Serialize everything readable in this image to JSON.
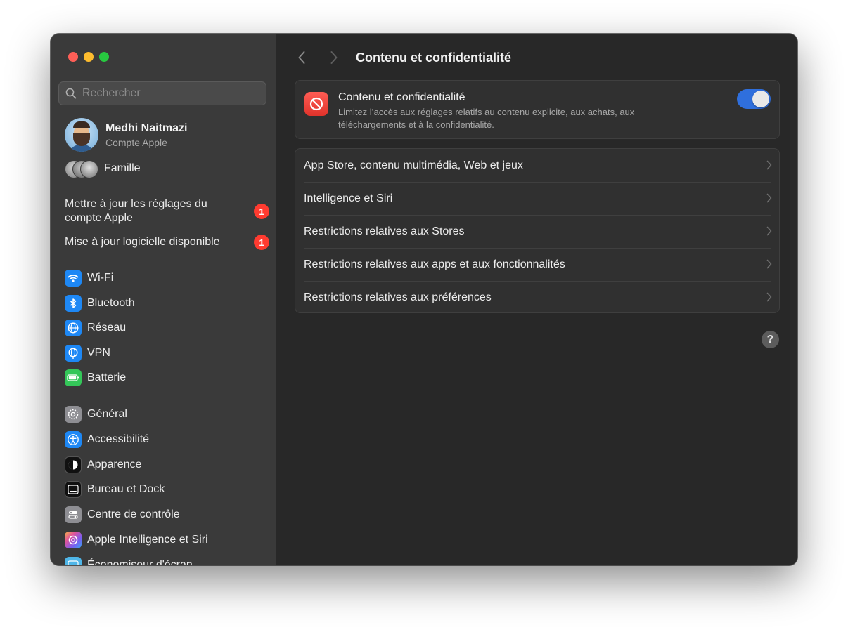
{
  "window": {
    "title": "Contenu et confidentialité"
  },
  "sidebar": {
    "search_placeholder": "Rechercher",
    "account": {
      "name": "Medhi Naitmazi",
      "subtitle": "Compte Apple"
    },
    "family_label": "Famille",
    "notices": [
      {
        "label": "Mettre à jour les réglages du compte Apple",
        "badge": "1"
      },
      {
        "label": "Mise à jour logicielle disponible",
        "badge": "1"
      }
    ],
    "items": [
      {
        "label": "Wi-Fi",
        "icon": "wifi-icon",
        "color": "#1e88f5"
      },
      {
        "label": "Bluetooth",
        "icon": "bluetooth-icon",
        "color": "#1e88f5"
      },
      {
        "label": "Réseau",
        "icon": "globe-icon",
        "color": "#1e88f5"
      },
      {
        "label": "VPN",
        "icon": "vpn-globe-icon",
        "color": "#1e88f5"
      },
      {
        "label": "Batterie",
        "icon": "battery-icon",
        "color": "#34c759"
      },
      {
        "label": "Général",
        "icon": "gear-icon",
        "color": "#8e8e93"
      },
      {
        "label": "Accessibilité",
        "icon": "accessibility-icon",
        "color": "#1e88f5"
      },
      {
        "label": "Apparence",
        "icon": "appearance-icon",
        "color": "#111111"
      },
      {
        "label": "Bureau et Dock",
        "icon": "dock-icon",
        "color": "#111111"
      },
      {
        "label": "Centre de contrôle",
        "icon": "control-center-icon",
        "color": "#8e8e93"
      },
      {
        "label": "Apple Intelligence et Siri",
        "icon": "siri-icon",
        "color": "#d05cd6"
      },
      {
        "label": "Économiseur d'écran",
        "icon": "screensaver-icon",
        "color": "#4fb6e8"
      }
    ]
  },
  "main": {
    "title": "Contenu et confidentialité",
    "hero": {
      "title": "Contenu et confidentialité",
      "description": "Limitez l’accès aux réglages relatifs au contenu explicite, aux achats, aux téléchargements et à la confidentialité.",
      "toggle_on": true
    },
    "rows": [
      "App Store, contenu multimédia, Web et jeux",
      "Intelligence et Siri",
      "Restrictions relatives aux Stores",
      "Restrictions relatives aux apps et aux fonctionnalités",
      "Restrictions relatives aux préférences"
    ],
    "help_label": "?"
  },
  "colors": {
    "accent": "#2f6fdd",
    "badge": "#ff3b30",
    "sidebar_bg": "#3a3a3a",
    "content_bg": "#282828"
  }
}
